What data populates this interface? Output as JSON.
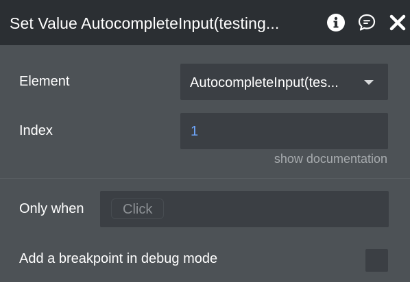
{
  "header": {
    "title": "Set Value AutocompleteInput(testing...",
    "icons": [
      "info-icon",
      "comment-icon",
      "close-icon"
    ]
  },
  "fields": {
    "element": {
      "label": "Element",
      "value": "AutocompleteInput(tes..."
    },
    "index": {
      "label": "Index",
      "value": "1"
    },
    "doc_link": "show documentation",
    "only_when": {
      "label": "Only when",
      "placeholder": "Click"
    },
    "breakpoint": {
      "label": "Add a breakpoint in debug mode",
      "checked": false
    }
  },
  "colors": {
    "header_bg": "#2b2f33",
    "panel_bg": "#4d5256",
    "field_bg": "#3b3f44",
    "accent_blue": "#6fa8ff",
    "muted_text": "#a7abae"
  }
}
